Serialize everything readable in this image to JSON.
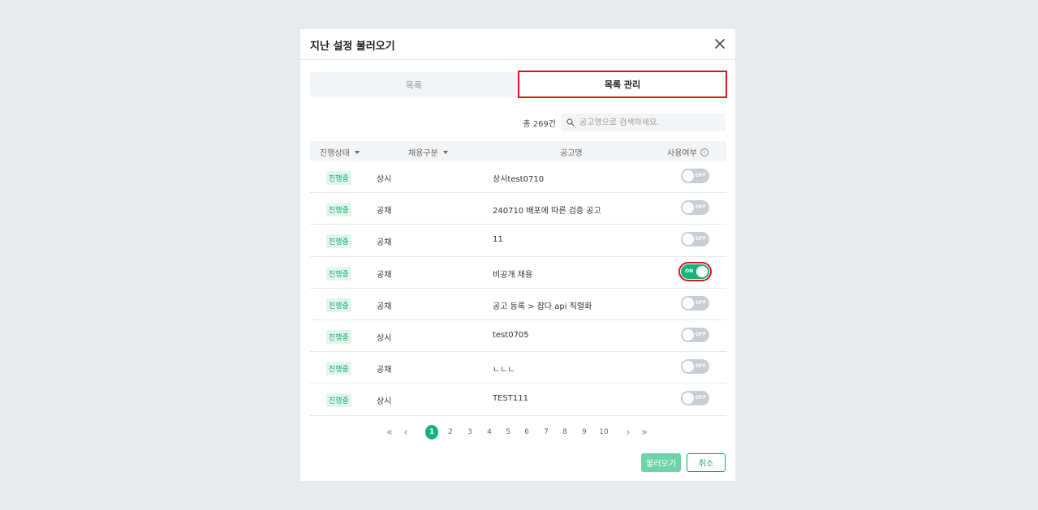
{
  "modal": {
    "title": "지난 설정 불러오기"
  },
  "tabs": {
    "list": "목록",
    "manage": "목록 관리"
  },
  "search": {
    "total": "총 269건",
    "placeholder": "공고명으로 검색하세요."
  },
  "table": {
    "headers": {
      "status": "진행상태",
      "type": "채용구분",
      "name": "공고명",
      "usage": "사용여부"
    },
    "rows": [
      {
        "status": "진행중",
        "type": "상시",
        "name": "상시test0710",
        "toggle": "OFF"
      },
      {
        "status": "진행중",
        "type": "공채",
        "name": "240710 배포에 따른 검증 공고",
        "toggle": "OFF"
      },
      {
        "status": "진행중",
        "type": "공채",
        "name": "11",
        "toggle": "OFF"
      },
      {
        "status": "진행중",
        "type": "공채",
        "name": "비공개 채용",
        "toggle": "ON"
      },
      {
        "status": "진행중",
        "type": "공채",
        "name": "공고 등록 > 잡다 api 직렬화",
        "toggle": "OFF"
      },
      {
        "status": "진행중",
        "type": "상시",
        "name": "test0705",
        "toggle": "OFF"
      },
      {
        "status": "진행중",
        "type": "공채",
        "name": "ㄴㄴㄴ",
        "toggle": "OFF"
      },
      {
        "status": "진행중",
        "type": "상시",
        "name": "TEST111",
        "toggle": "OFF"
      }
    ]
  },
  "pagination": {
    "pages": [
      "1",
      "2",
      "3",
      "4",
      "5",
      "6",
      "7",
      "8",
      "9",
      "10"
    ],
    "current": "1"
  },
  "footer": {
    "load": "불러오기",
    "cancel": "취소"
  },
  "colors": {
    "accent": "#13b576",
    "highlight": "#e0141e"
  }
}
